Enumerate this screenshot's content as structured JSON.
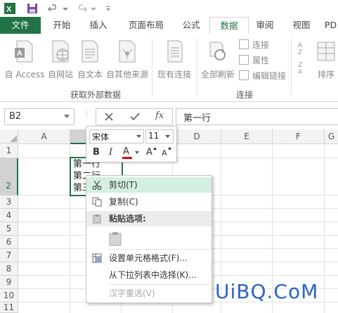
{
  "ribbon_tabs": [
    "文件",
    "开始",
    "插入",
    "页面布局",
    "公式",
    "数据",
    "审阅",
    "视图",
    "PD"
  ],
  "active_tab": "数据",
  "ribbon": {
    "get_external": {
      "buttons": [
        "自 Access",
        "自网站",
        "自文本",
        "自其他来源"
      ],
      "existing": "现有连接",
      "label": "获取外部数据"
    },
    "connections": {
      "refresh_all": "全部刷新",
      "small": [
        "连接",
        "属性",
        "编辑链接"
      ],
      "label": "连接"
    },
    "sort": "排序",
    "sort_icon_text": [
      "A",
      "Z",
      "Z",
      "A"
    ]
  },
  "formula_bar": {
    "name_box": "B2",
    "fx": "fx",
    "content": "第一行"
  },
  "grid": {
    "columns": [
      "A",
      "B",
      "C",
      "D",
      "E",
      "F",
      "G"
    ],
    "rows": [
      "1",
      "2",
      "3",
      "4",
      "5",
      "6",
      "7",
      "8",
      "9",
      "10",
      "11"
    ],
    "cell_b2_lines": [
      "第一行",
      "第二行",
      "第三行"
    ]
  },
  "mini_toolbar": {
    "font": "宋体",
    "size": "11",
    "bold": "B",
    "italic": "I",
    "font_color": "A",
    "grow": "A",
    "shrink": "A"
  },
  "context_menu": {
    "cut": "剪切(T)",
    "copy": "复制(C)",
    "paste_options": "粘贴选项:",
    "format_cells": "设置单元格格式(F)...",
    "pick_from_list": "从下拉列表中选择(K)...",
    "hanzi_reselect": "汉字重选(V)"
  },
  "watermark": "UiBQ.CoM",
  "colors": {
    "excel_green": "#217346",
    "highlight": "#d3f0e0"
  }
}
